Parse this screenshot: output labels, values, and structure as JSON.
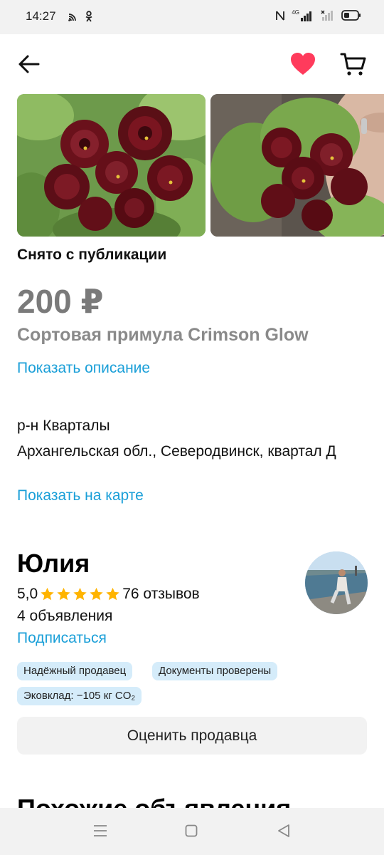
{
  "status_bar": {
    "time": "14:27",
    "signal_label": "4G"
  },
  "header": {
    "back_icon": "arrow-left-icon",
    "favorite_icon": "heart-icon",
    "cart_icon": "cart-icon",
    "favorite_color": "#ff3b5c"
  },
  "listing": {
    "status": "Снято с публикации",
    "price": "200 ₽",
    "title": "Сортовая примула Crimson Glow",
    "show_description": "Показать описание",
    "district": "р-н Кварталы",
    "address": "Архангельская обл., Северодвинск, квартал Д",
    "show_on_map": "Показать на карте"
  },
  "seller": {
    "name": "Юлия",
    "rating": "5,0",
    "stars": 5,
    "reviews": "76 отзывов",
    "ads_count": "4 объявления",
    "subscribe": "Подписаться",
    "badges": [
      "Надёжный продавец",
      "Документы проверены",
      "Эковклад: −105 кг CO₂"
    ],
    "rate_button": "Оценить продавца"
  },
  "similar": {
    "heading": "Похожие объявления"
  },
  "colors": {
    "link": "#1a9fd8",
    "star": "#ffb400",
    "badge_bg": "#d5ecfa"
  }
}
